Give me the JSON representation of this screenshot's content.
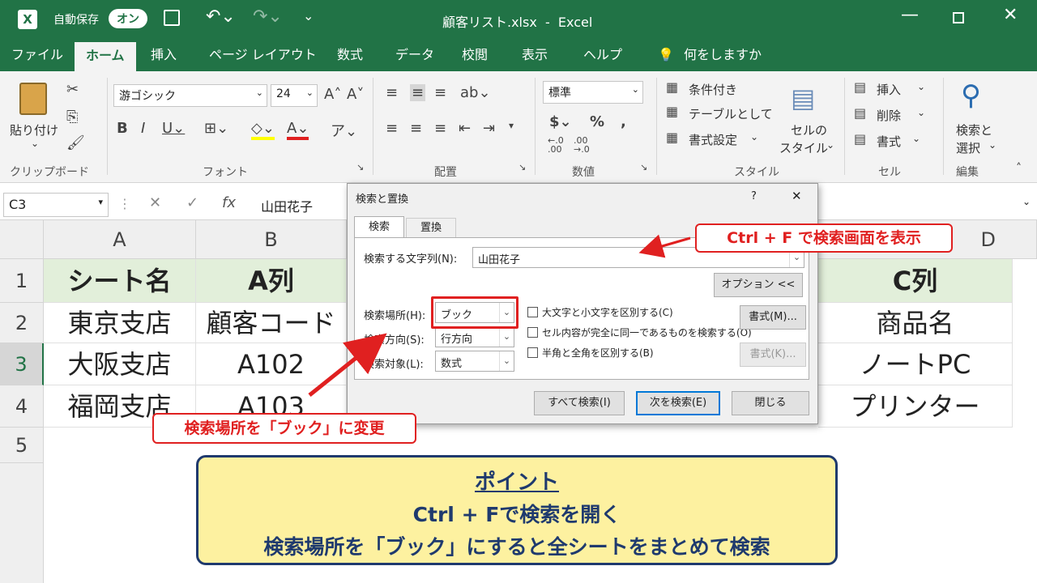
{
  "titlebar": {
    "autosave_label": "自動保存",
    "autosave_toggle": "オン",
    "file_title": "顧客リスト.xlsx  -  Excel"
  },
  "tabs": [
    "ファイル",
    "ホーム",
    "挿入",
    "ページ レイアウト",
    "数式",
    "データ",
    "校閲",
    "表示",
    "ヘルプ"
  ],
  "tell_me": "何をしますか",
  "ribbon": {
    "paste": "貼り付け",
    "clipboard": "クリップボード",
    "font_name": "游ゴシック",
    "font_size": "24",
    "font_group": "フォント",
    "align_group": "配置",
    "number_format": "標準",
    "number_group": "数値",
    "cond_format": "条件付き",
    "table_format": "テーブルとして",
    "cell_format": "書式設定",
    "cell_style_1": "セルの",
    "cell_style_2": "スタイル",
    "style_group": "スタイル",
    "insert": "挿入",
    "delete": "削除",
    "format": "書式",
    "cells_group": "セル",
    "find_select_1": "検索と",
    "find_select_2": "選択",
    "edit_group": "編集"
  },
  "formula": {
    "name_box": "C3",
    "fx": "fx",
    "value": "山田花子"
  },
  "columns": [
    "A",
    "B",
    "D"
  ],
  "rows": [
    "1",
    "2",
    "3",
    "4",
    "5"
  ],
  "cells": {
    "a1": "シート名",
    "b1": "A列",
    "d1": "C列",
    "a2": "東京支店",
    "b2": "顧客コード",
    "d2": "商品名",
    "a3": "大阪支店",
    "b3": "A102",
    "d3": "ノートPC",
    "a4": "福岡支店",
    "b4": "A103",
    "d4": "プリンター"
  },
  "dialog": {
    "title": "検索と置換",
    "help": "?",
    "close": "✕",
    "tab_find": "検索",
    "tab_replace": "置換",
    "find_label": "検索する文字列(N):",
    "find_value": "山田花子",
    "options_button": "オプション <<",
    "within_label": "検索場所(H):",
    "within_value": "ブック",
    "search_label": "検索方向(S):",
    "search_value": "行方向",
    "lookin_label": "検索対象(L):",
    "lookin_value": "数式",
    "match_case": "大文字と小文字を区別する(C)",
    "match_entire": "セル内容が完全に同一であるものを検索する(O)",
    "match_byte": "半角と全角を区別する(B)",
    "format_button": "書式(M)...",
    "format_button_disabled": "書式(K)...",
    "find_all": "すべて検索(I)",
    "find_next": "次を検索(E)",
    "close_button": "閉じる"
  },
  "callouts": {
    "top": "Ctrl + F で検索画面を表示",
    "bottom": "検索場所を「ブック」に変更"
  },
  "point": {
    "title": "ポイント",
    "line1": "Ctrl + Fで検索を開く",
    "line2": "検索場所を「ブック」にすると全シートをまとめて検索"
  },
  "colors": {
    "excel_green": "#217346",
    "header_fill": "#e2efda",
    "callout_red": "#e02020",
    "point_fill": "#fdf1a0",
    "point_border": "#1f3a6e"
  }
}
